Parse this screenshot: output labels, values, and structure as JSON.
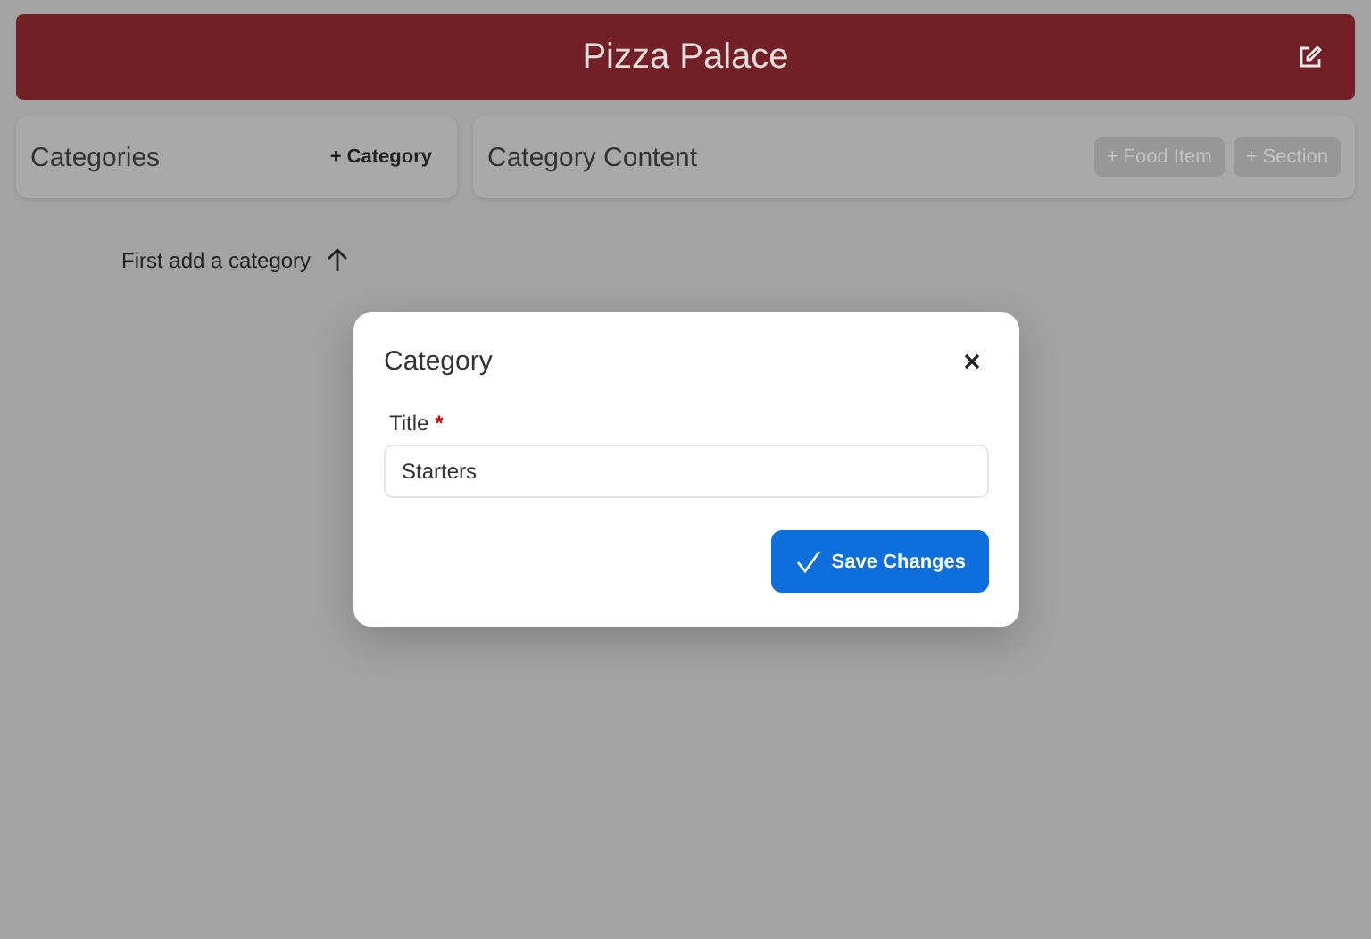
{
  "header": {
    "title": "Pizza Palace"
  },
  "categories_panel": {
    "title": "Categories",
    "add_button": {
      "label": "+ Category",
      "disabled": false
    }
  },
  "content_panel": {
    "title": "Category Content",
    "buttons": [
      {
        "label": "+ Food Item",
        "disabled": true
      },
      {
        "label": "+ Section",
        "disabled": true
      }
    ]
  },
  "empty_hint": "First add a category",
  "dialog": {
    "title": "Category",
    "field": {
      "label": "Title",
      "required_mark": "*",
      "value": "Starters"
    },
    "save_button": "Save Changes"
  }
}
